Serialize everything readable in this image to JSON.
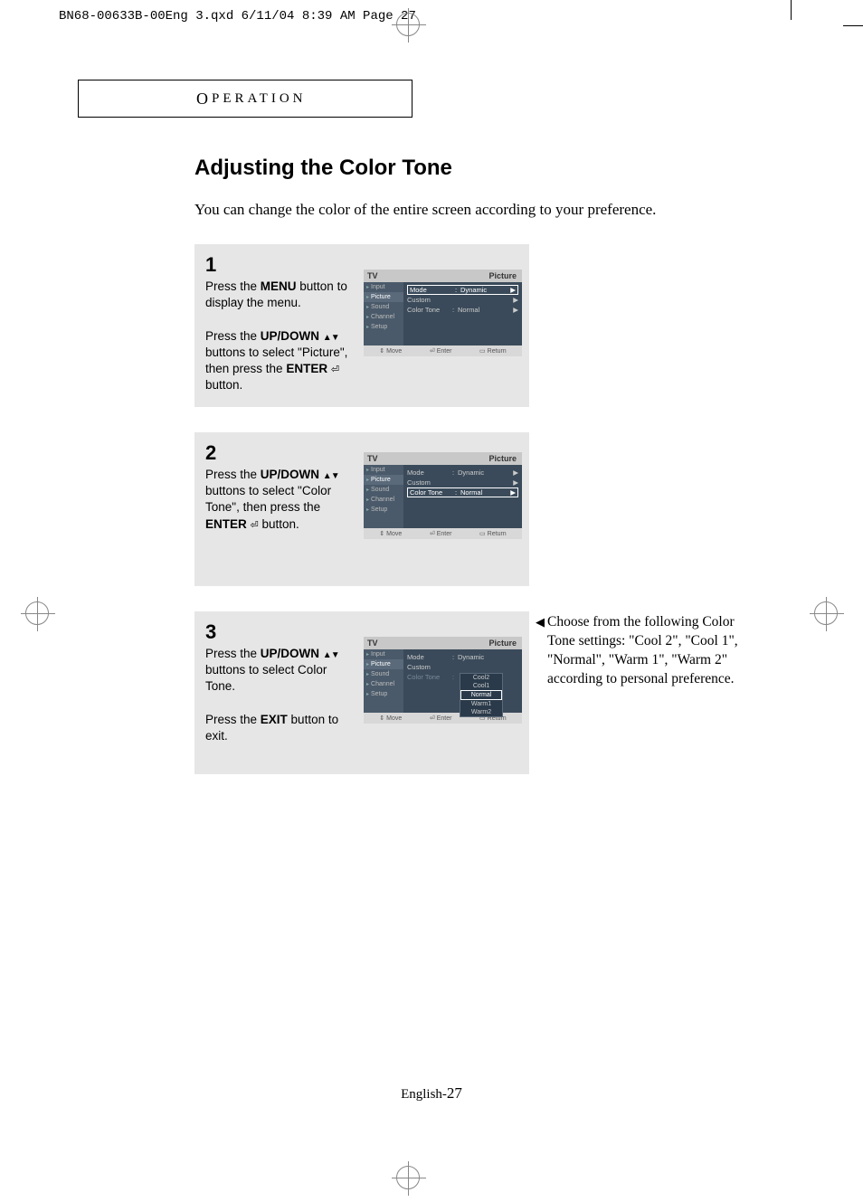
{
  "print_header": "BN68-00633B-00Eng 3.qxd  6/11/04 8:39 AM  Page 27",
  "section_header_first": "O",
  "section_header_rest": "PERATION",
  "title": "Adjusting the Color Tone",
  "intro": "You can change the color of the entire screen according to your preference.",
  "steps": {
    "s1": {
      "num": "1",
      "p1a": "Press the ",
      "p1b": "MENU",
      "p1c": " button to display the menu.",
      "p2a": "Press the ",
      "p2b": "UP/DOWN",
      "p2c": " buttons to select \"Picture\", then press the ",
      "p2d": "ENTER",
      "p2e": " button."
    },
    "s2": {
      "num": "2",
      "p1a": "Press the ",
      "p1b": "UP/DOWN",
      "p1c": " buttons to select \"Color Tone\", then press the ",
      "p1d": "ENTER",
      "p1e": " button."
    },
    "s3": {
      "num": "3",
      "p1a": "Press the ",
      "p1b": "UP/DOWN",
      "p1c": " buttons to select Color Tone.",
      "p2a": "Press the ",
      "p2b": "EXIT",
      "p2c": " button to exit."
    }
  },
  "osd": {
    "tv": "TV",
    "category": "Picture",
    "side": {
      "input": "Input",
      "picture": "Picture",
      "sound": "Sound",
      "channel": "Channel",
      "setup": "Setup"
    },
    "rows": {
      "mode": "Mode",
      "custom": "Custom",
      "colortone": "Color Tone",
      "dynamic": "Dynamic",
      "normal": "Normal",
      "colon": ":",
      "arrow": "▶"
    },
    "dropdown": {
      "cool2": "Cool2",
      "cool1": "Cool1",
      "normal": "Normal",
      "warm1": "Warm1",
      "warm2": "Warm2"
    },
    "footer": {
      "move": "Move",
      "enter": "Enter",
      "return": "Return"
    }
  },
  "sidenote": "Choose from the following Color Tone settings: \"Cool 2\", \"Cool 1\", \"Normal\", \"Warm 1\", \"Warm 2\" according to personal preference.",
  "pagenum_prefix": "English-",
  "pagenum": "27"
}
